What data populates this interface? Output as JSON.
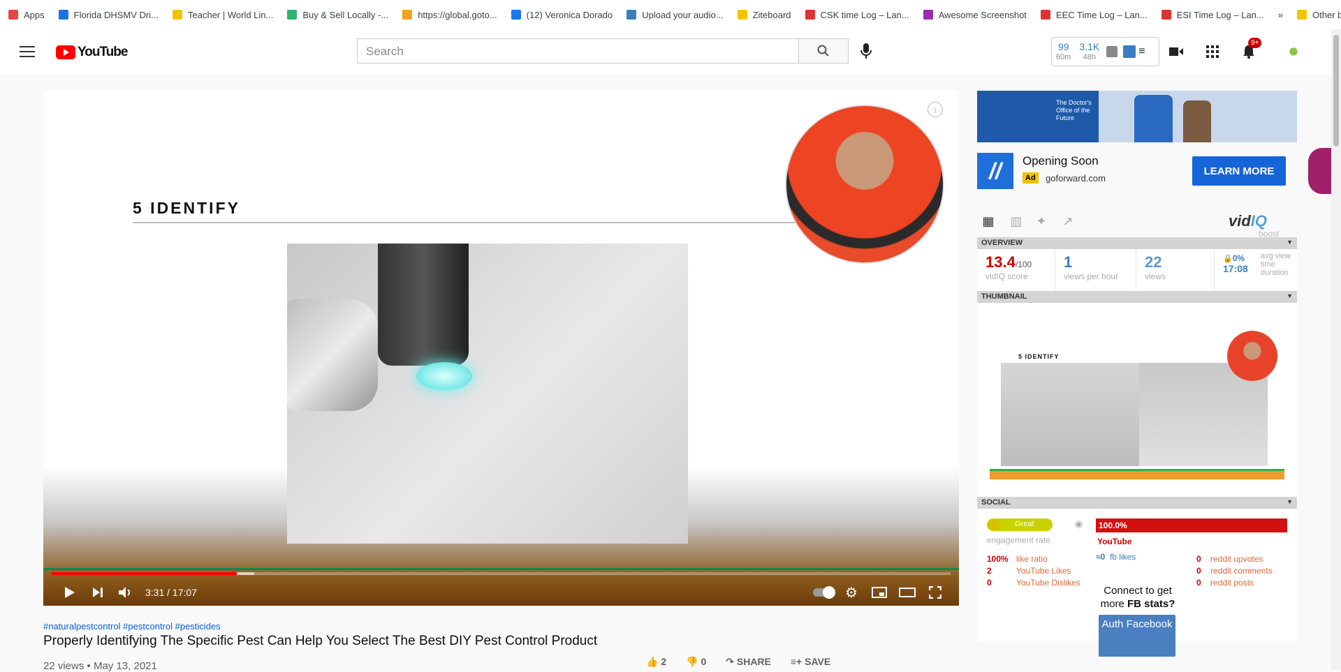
{
  "bookmarks": [
    {
      "label": "Apps",
      "color": "#e44"
    },
    {
      "label": "Florida DHSMV Dri...",
      "color": "#1a73e8"
    },
    {
      "label": "Teacher | World Lin...",
      "color": "#f5c400"
    },
    {
      "label": "Buy & Sell Locally -...",
      "color": "#2bb673"
    },
    {
      "label": "https://global.goto...",
      "color": "#f7a21b"
    },
    {
      "label": "(12) Veronica Dorado",
      "color": "#1877f2"
    },
    {
      "label": "Upload your audio...",
      "color": "#3a7fc0"
    },
    {
      "label": "Ziteboard",
      "color": "#f5c400"
    },
    {
      "label": "CSK time Log – Lan...",
      "color": "#d33"
    },
    {
      "label": "Awesome Screenshot",
      "color": "#9b2bb0"
    },
    {
      "label": "EEC Time Log – Lan...",
      "color": "#d33"
    },
    {
      "label": "ESI Time Log – Lan...",
      "color": "#d33"
    }
  ],
  "bookmarks_more": "»",
  "other_bookmarks": "Other bookmarks",
  "header": {
    "logo": "YouTube",
    "search_placeholder": "Search",
    "stat1_value": "99",
    "stat1_sub": "60m",
    "stat2_value": "3.1K",
    "stat2_sub": "48h",
    "notif_badge": "9+"
  },
  "video": {
    "slide_title": "5 IDENTIFY",
    "time": "3:31 / 17:07",
    "progress": 0.206,
    "buffered": 0.225,
    "tags": "#naturalpestcontrol #pestcontrol #pesticides",
    "title": "Properly Identifying The Specific Pest Can Help You Select The Best DIY Pest Control Product",
    "meta": "22 views • May 13, 2021",
    "likes": "2",
    "dislikes": "0",
    "share": "SHARE",
    "save": "SAVE"
  },
  "ad": {
    "banner_text": "The Doctor's Office of the Future",
    "title": "Opening Soon",
    "badge": "Ad",
    "domain": "goforward.com",
    "cta": "LEARN MORE"
  },
  "vidiq": {
    "brand": "vid",
    "brand2": "IQ",
    "boost": "boost",
    "overview_label": "OVERVIEW",
    "score": "13.4",
    "score_max": "/100",
    "score_label": "vidIQ score",
    "vph": "1",
    "vph_label": "views per hour",
    "views": "22",
    "views_label": "views",
    "avg_pct": "0%",
    "avg_time": "17:08",
    "avg_label": "avg view time duration",
    "thumbnail_label": "THUMBNAIL",
    "thumb_title": "5 IDENTIFY",
    "social_label": "SOCIAL",
    "engagement": "Great",
    "engagement_label": "engagement rate",
    "yt_pct": "100.0%",
    "yt_label": "YouTube",
    "like_ratio": "100%",
    "like_ratio_label": "like ratio",
    "yt_likes": "2",
    "yt_likes_label": "YouTube Likes",
    "yt_dislikes": "0",
    "yt_dislikes_label": "YouTube Dislikes",
    "fb_likes": "≈0",
    "fb_likes_label": "fb likes",
    "reddit_up": "0",
    "reddit_up_label": "reddit upvotes",
    "reddit_comments": "0",
    "reddit_comments_label": "reddit comments",
    "reddit_posts": "0",
    "reddit_posts_label": "reddit posts",
    "connect_text": "Connect to get more",
    "connect_fb": "FB",
    "connect_end": "stats?",
    "auth": "Auth Facebook"
  }
}
